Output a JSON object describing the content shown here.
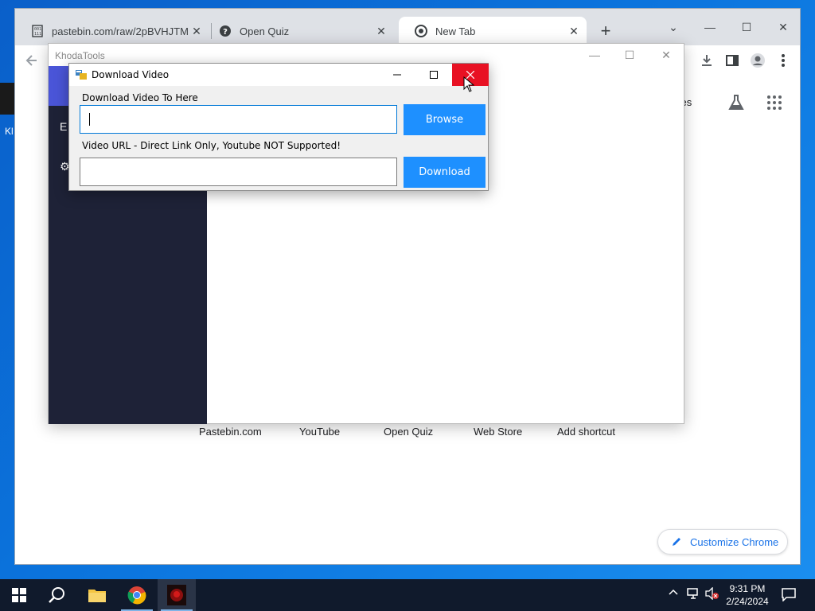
{
  "desktop": {
    "icon_label": "Kl"
  },
  "chrome": {
    "tabs": [
      {
        "label": "pastebin.com/raw/2pBVHJTM",
        "favicon": "document-icon"
      },
      {
        "label": "Open Quiz",
        "favicon": "question-circle-icon"
      },
      {
        "label": "New Tab",
        "favicon": "chrome-icon",
        "active": true
      }
    ],
    "apps_fragment": "ages",
    "shortcuts": [
      "Pastebin.com",
      "YouTube",
      "Open Quiz",
      "Web Store",
      "Add shortcut"
    ],
    "customize_label": "Customize Chrome"
  },
  "khoda": {
    "title": "KhodaTools",
    "side_items": [
      "E",
      "⚙"
    ]
  },
  "dialog": {
    "title": "Download Video",
    "dest_label": "Download Video To Here",
    "dest_value": "",
    "browse_label": "Browse",
    "url_label": "Video URL - Direct Link Only, Youtube NOT Supported!",
    "url_value": "",
    "download_label": "Download"
  },
  "taskbar": {
    "time": "9:31 PM",
    "date": "2/24/2024"
  },
  "colors": {
    "close_red": "#e81123",
    "accent_blue": "#1e90ff",
    "sidebar_navy": "#1e2237",
    "taskbar": "#101a2c"
  }
}
